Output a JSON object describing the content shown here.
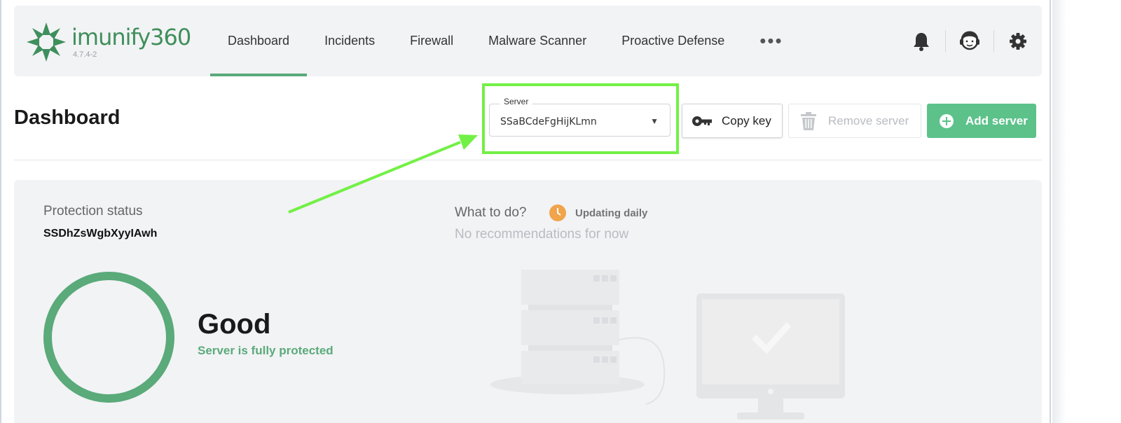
{
  "app": {
    "logo_text": "imunify360",
    "version": "4.7.4-2"
  },
  "nav": {
    "items": [
      {
        "label": "Dashboard",
        "active": true
      },
      {
        "label": "Incidents",
        "active": false
      },
      {
        "label": "Firewall",
        "active": false
      },
      {
        "label": "Malware Scanner",
        "active": false
      },
      {
        "label": "Proactive Defense",
        "active": false
      }
    ],
    "more_label": "•••",
    "icons": [
      "bell-icon",
      "support-agent-icon",
      "gear-icon"
    ]
  },
  "page": {
    "title": "Dashboard"
  },
  "server_select": {
    "legend": "Server",
    "value": "SSaBCdeFgHijKLmn"
  },
  "buttons": {
    "copy_key": "Copy key",
    "remove_server": "Remove server",
    "add_server": "Add server"
  },
  "protection": {
    "label": "Protection status",
    "server": "SSDhZsWgbXyyIAwh",
    "status": "Good",
    "status_sub": "Server is fully protected"
  },
  "recommendations": {
    "label": "What to do?",
    "updating": "Updating daily",
    "empty": "No recommendations for now"
  },
  "colors": {
    "brand_green": "#3f8f5c",
    "accent_green": "#5aaa7a",
    "add_button": "#5cc28a",
    "highlight": "#73f046",
    "clock": "#f0a44c"
  }
}
